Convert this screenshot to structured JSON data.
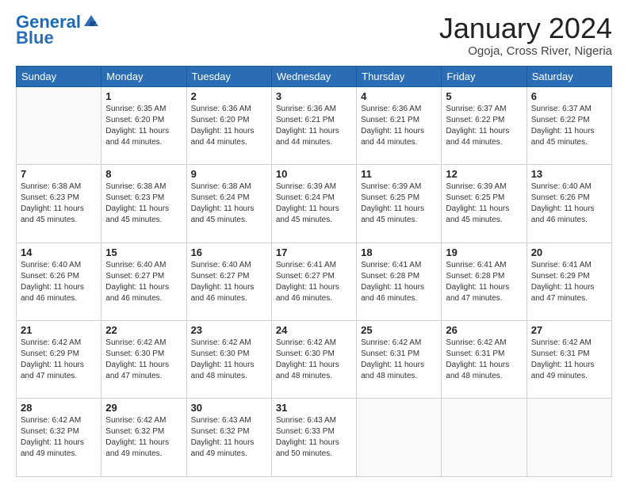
{
  "logo": {
    "line1": "General",
    "line2": "Blue"
  },
  "calendar": {
    "title": "January 2024",
    "subtitle": "Ogoja, Cross River, Nigeria",
    "days_of_week": [
      "Sunday",
      "Monday",
      "Tuesday",
      "Wednesday",
      "Thursday",
      "Friday",
      "Saturday"
    ],
    "weeks": [
      [
        {
          "day": "",
          "sunrise": "",
          "sunset": "",
          "daylight": ""
        },
        {
          "day": "1",
          "sunrise": "Sunrise: 6:35 AM",
          "sunset": "Sunset: 6:20 PM",
          "daylight": "Daylight: 11 hours and 44 minutes."
        },
        {
          "day": "2",
          "sunrise": "Sunrise: 6:36 AM",
          "sunset": "Sunset: 6:20 PM",
          "daylight": "Daylight: 11 hours and 44 minutes."
        },
        {
          "day": "3",
          "sunrise": "Sunrise: 6:36 AM",
          "sunset": "Sunset: 6:21 PM",
          "daylight": "Daylight: 11 hours and 44 minutes."
        },
        {
          "day": "4",
          "sunrise": "Sunrise: 6:36 AM",
          "sunset": "Sunset: 6:21 PM",
          "daylight": "Daylight: 11 hours and 44 minutes."
        },
        {
          "day": "5",
          "sunrise": "Sunrise: 6:37 AM",
          "sunset": "Sunset: 6:22 PM",
          "daylight": "Daylight: 11 hours and 44 minutes."
        },
        {
          "day": "6",
          "sunrise": "Sunrise: 6:37 AM",
          "sunset": "Sunset: 6:22 PM",
          "daylight": "Daylight: 11 hours and 45 minutes."
        }
      ],
      [
        {
          "day": "7",
          "sunrise": "Sunrise: 6:38 AM",
          "sunset": "Sunset: 6:23 PM",
          "daylight": "Daylight: 11 hours and 45 minutes."
        },
        {
          "day": "8",
          "sunrise": "Sunrise: 6:38 AM",
          "sunset": "Sunset: 6:23 PM",
          "daylight": "Daylight: 11 hours and 45 minutes."
        },
        {
          "day": "9",
          "sunrise": "Sunrise: 6:38 AM",
          "sunset": "Sunset: 6:24 PM",
          "daylight": "Daylight: 11 hours and 45 minutes."
        },
        {
          "day": "10",
          "sunrise": "Sunrise: 6:39 AM",
          "sunset": "Sunset: 6:24 PM",
          "daylight": "Daylight: 11 hours and 45 minutes."
        },
        {
          "day": "11",
          "sunrise": "Sunrise: 6:39 AM",
          "sunset": "Sunset: 6:25 PM",
          "daylight": "Daylight: 11 hours and 45 minutes."
        },
        {
          "day": "12",
          "sunrise": "Sunrise: 6:39 AM",
          "sunset": "Sunset: 6:25 PM",
          "daylight": "Daylight: 11 hours and 45 minutes."
        },
        {
          "day": "13",
          "sunrise": "Sunrise: 6:40 AM",
          "sunset": "Sunset: 6:26 PM",
          "daylight": "Daylight: 11 hours and 46 minutes."
        }
      ],
      [
        {
          "day": "14",
          "sunrise": "Sunrise: 6:40 AM",
          "sunset": "Sunset: 6:26 PM",
          "daylight": "Daylight: 11 hours and 46 minutes."
        },
        {
          "day": "15",
          "sunrise": "Sunrise: 6:40 AM",
          "sunset": "Sunset: 6:27 PM",
          "daylight": "Daylight: 11 hours and 46 minutes."
        },
        {
          "day": "16",
          "sunrise": "Sunrise: 6:40 AM",
          "sunset": "Sunset: 6:27 PM",
          "daylight": "Daylight: 11 hours and 46 minutes."
        },
        {
          "day": "17",
          "sunrise": "Sunrise: 6:41 AM",
          "sunset": "Sunset: 6:27 PM",
          "daylight": "Daylight: 11 hours and 46 minutes."
        },
        {
          "day": "18",
          "sunrise": "Sunrise: 6:41 AM",
          "sunset": "Sunset: 6:28 PM",
          "daylight": "Daylight: 11 hours and 46 minutes."
        },
        {
          "day": "19",
          "sunrise": "Sunrise: 6:41 AM",
          "sunset": "Sunset: 6:28 PM",
          "daylight": "Daylight: 11 hours and 47 minutes."
        },
        {
          "day": "20",
          "sunrise": "Sunrise: 6:41 AM",
          "sunset": "Sunset: 6:29 PM",
          "daylight": "Daylight: 11 hours and 47 minutes."
        }
      ],
      [
        {
          "day": "21",
          "sunrise": "Sunrise: 6:42 AM",
          "sunset": "Sunset: 6:29 PM",
          "daylight": "Daylight: 11 hours and 47 minutes."
        },
        {
          "day": "22",
          "sunrise": "Sunrise: 6:42 AM",
          "sunset": "Sunset: 6:30 PM",
          "daylight": "Daylight: 11 hours and 47 minutes."
        },
        {
          "day": "23",
          "sunrise": "Sunrise: 6:42 AM",
          "sunset": "Sunset: 6:30 PM",
          "daylight": "Daylight: 11 hours and 48 minutes."
        },
        {
          "day": "24",
          "sunrise": "Sunrise: 6:42 AM",
          "sunset": "Sunset: 6:30 PM",
          "daylight": "Daylight: 11 hours and 48 minutes."
        },
        {
          "day": "25",
          "sunrise": "Sunrise: 6:42 AM",
          "sunset": "Sunset: 6:31 PM",
          "daylight": "Daylight: 11 hours and 48 minutes."
        },
        {
          "day": "26",
          "sunrise": "Sunrise: 6:42 AM",
          "sunset": "Sunset: 6:31 PM",
          "daylight": "Daylight: 11 hours and 48 minutes."
        },
        {
          "day": "27",
          "sunrise": "Sunrise: 6:42 AM",
          "sunset": "Sunset: 6:31 PM",
          "daylight": "Daylight: 11 hours and 49 minutes."
        }
      ],
      [
        {
          "day": "28",
          "sunrise": "Sunrise: 6:42 AM",
          "sunset": "Sunset: 6:32 PM",
          "daylight": "Daylight: 11 hours and 49 minutes."
        },
        {
          "day": "29",
          "sunrise": "Sunrise: 6:42 AM",
          "sunset": "Sunset: 6:32 PM",
          "daylight": "Daylight: 11 hours and 49 minutes."
        },
        {
          "day": "30",
          "sunrise": "Sunrise: 6:43 AM",
          "sunset": "Sunset: 6:32 PM",
          "daylight": "Daylight: 11 hours and 49 minutes."
        },
        {
          "day": "31",
          "sunrise": "Sunrise: 6:43 AM",
          "sunset": "Sunset: 6:33 PM",
          "daylight": "Daylight: 11 hours and 50 minutes."
        },
        {
          "day": "",
          "sunrise": "",
          "sunset": "",
          "daylight": ""
        },
        {
          "day": "",
          "sunrise": "",
          "sunset": "",
          "daylight": ""
        },
        {
          "day": "",
          "sunrise": "",
          "sunset": "",
          "daylight": ""
        }
      ]
    ]
  }
}
